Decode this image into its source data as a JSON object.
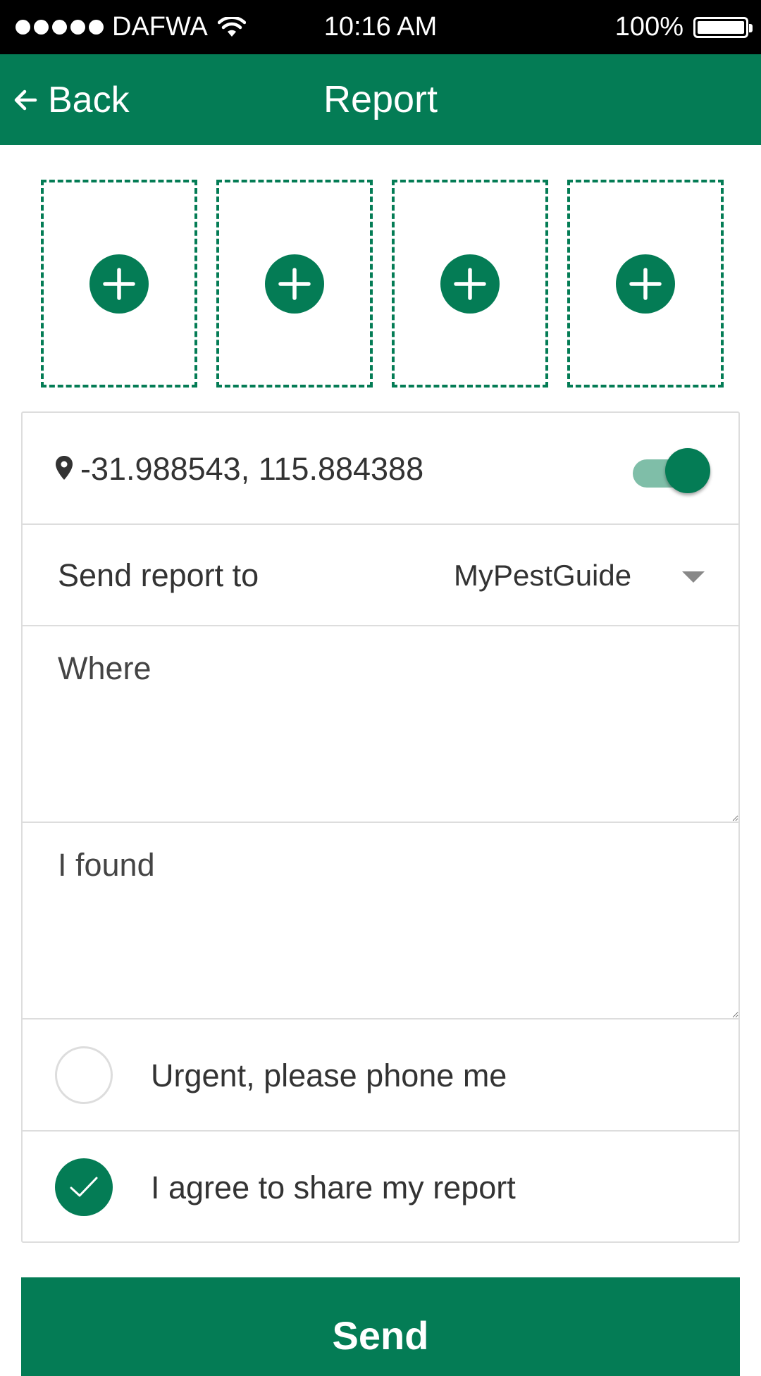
{
  "status_bar": {
    "carrier": "DAFWA",
    "time": "10:16 AM",
    "battery": "100%"
  },
  "header": {
    "back_label": "Back",
    "title": "Report"
  },
  "photo_slots": [
    "add-photo",
    "add-photo",
    "add-photo",
    "add-photo"
  ],
  "form": {
    "location": {
      "coordinates": "-31.988543, 115.884388",
      "toggle_on": true
    },
    "send_to": {
      "label": "Send report to",
      "selected": "MyPestGuide"
    },
    "where_placeholder": "Where",
    "found_placeholder": "I found",
    "urgent": {
      "label": "Urgent, please phone me",
      "checked": false
    },
    "agree": {
      "label": "I agree to share my report",
      "checked": true
    }
  },
  "send_label": "Send",
  "colors": {
    "brand_green": "#047c55",
    "toggle_track": "#7fbea8",
    "border": "#dddddd"
  }
}
